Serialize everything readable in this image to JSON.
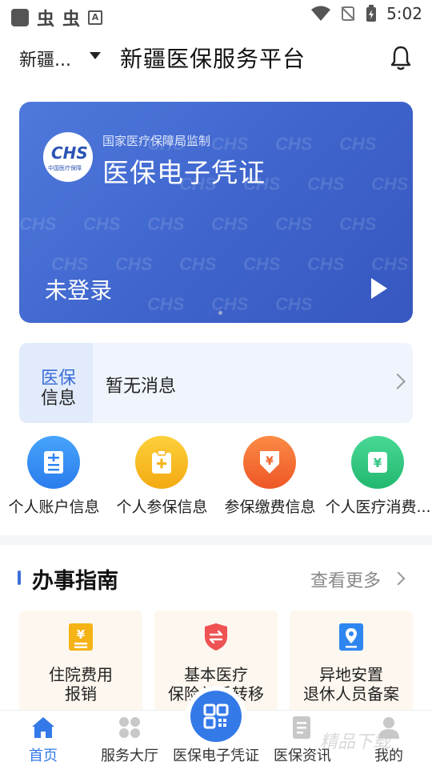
{
  "status_bar": {
    "time": "5:02",
    "notif_glyph_1": "虫",
    "notif_glyph_2": "虫",
    "notif_a": "A"
  },
  "header": {
    "city": "新疆...",
    "title": "新疆医保服务平台"
  },
  "card": {
    "logo_text": "CHS",
    "logo_sub": "中国医疗保障",
    "subtitle": "国家医疗保障局监制",
    "title": "医保电子凭证",
    "status": "未登录",
    "colors": {
      "start": "#4f79dc",
      "end": "#3657bf"
    }
  },
  "message": {
    "tag_line1": "医保",
    "tag_line2": "信息",
    "text": "暂无消息"
  },
  "quick_actions": [
    {
      "label": "个人账户信息",
      "icon": "account-list-icon",
      "color": "#2f86f0"
    },
    {
      "label": "个人参保信息",
      "icon": "clipboard-plus-icon",
      "color": "#f6b316"
    },
    {
      "label": "参保缴费信息",
      "icon": "yuan-down-icon",
      "color": "#f1642c"
    },
    {
      "label": "个人医疗消费...",
      "icon": "yuan-card-icon",
      "color": "#2fc57e"
    }
  ],
  "guide": {
    "title": "办事指南",
    "more": "查看更多",
    "items": [
      {
        "line1": "住院费用",
        "line2": "报销",
        "icon": "yuan-doc-icon",
        "color": "#f6b316"
      },
      {
        "line1": "基本医疗",
        "line2": "保险关系转移",
        "icon": "shield-transfer-icon",
        "color": "#ee5252"
      },
      {
        "line1": "异地安置",
        "line2": "退休人员备案",
        "icon": "location-pin-icon",
        "color": "#2f86f0"
      }
    ]
  },
  "tabbar": {
    "items": [
      {
        "label": "首页",
        "icon": "home-icon",
        "active": true
      },
      {
        "label": "服务大厅",
        "icon": "grid-icon",
        "active": false
      },
      {
        "label": "医保电子凭证",
        "icon": "qr-code-icon",
        "active": false
      },
      {
        "label": "医保资讯",
        "icon": "news-icon",
        "active": false
      },
      {
        "label": "我的",
        "icon": "person-icon",
        "active": false
      }
    ],
    "accent": "#3479e8"
  },
  "watermark": "精品下载"
}
